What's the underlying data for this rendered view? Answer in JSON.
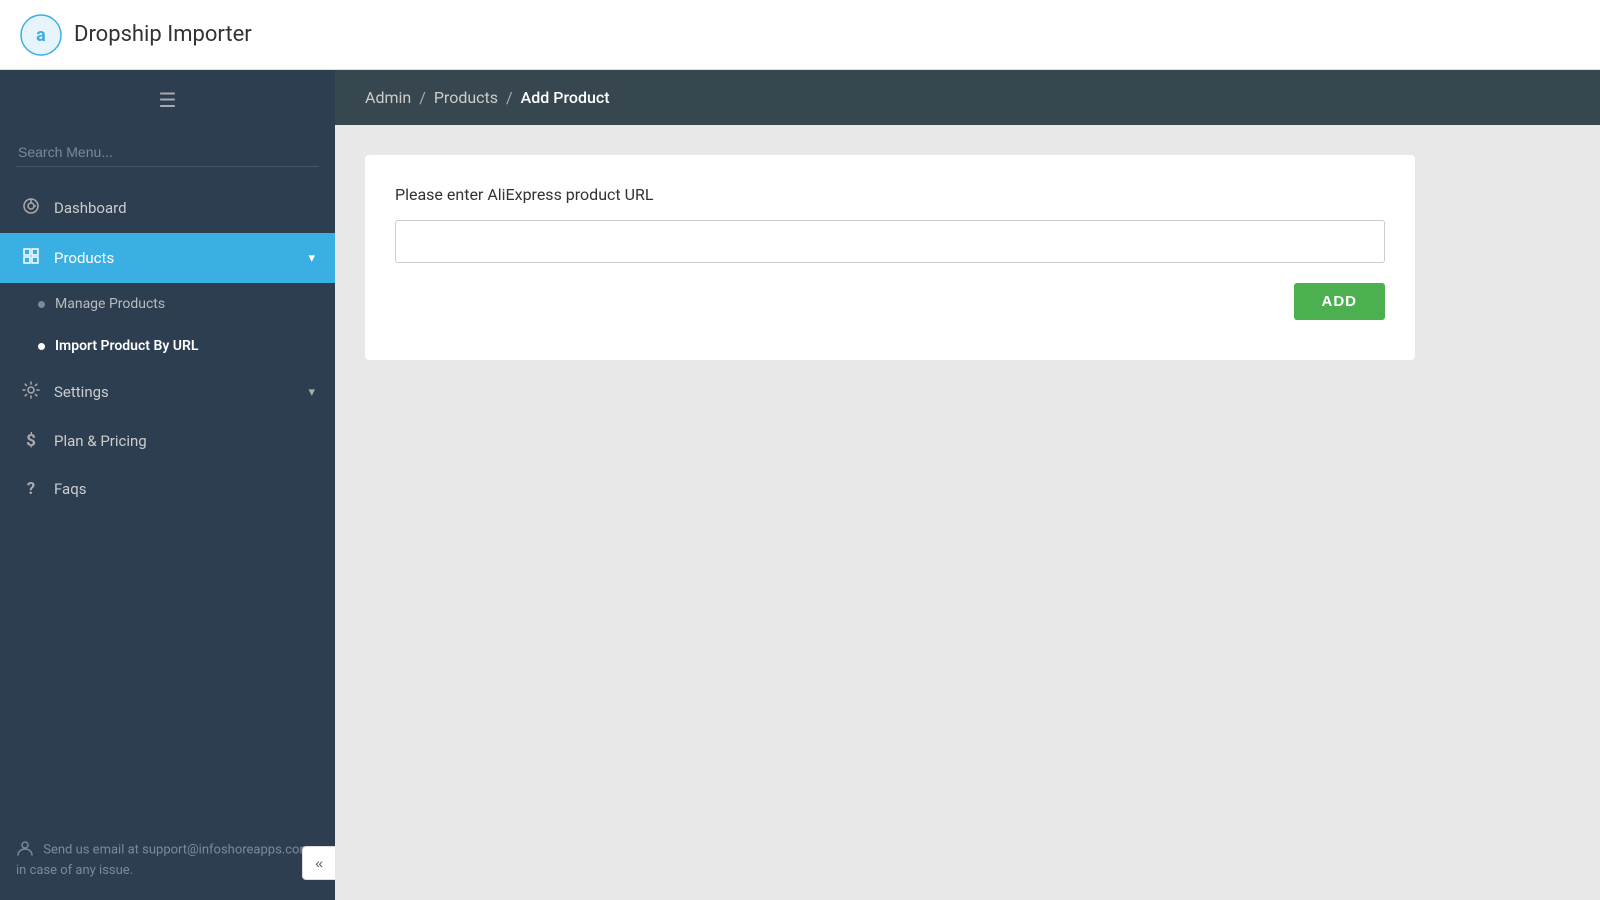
{
  "app": {
    "title": "Dropship Importer"
  },
  "sidebar": {
    "search_placeholder": "Search Menu...",
    "items": [
      {
        "id": "dashboard",
        "label": "Dashboard",
        "icon": "dashboard",
        "has_sub": false
      },
      {
        "id": "products",
        "label": "Products",
        "icon": "products",
        "has_sub": true,
        "active": true
      },
      {
        "id": "settings",
        "label": "Settings",
        "icon": "settings",
        "has_sub": true
      },
      {
        "id": "plan",
        "label": "Plan & Pricing",
        "icon": "dollar",
        "has_sub": false
      },
      {
        "id": "faqs",
        "label": "Faqs",
        "icon": "question",
        "has_sub": false
      }
    ],
    "subnav": [
      {
        "id": "manage-products",
        "label": "Manage Products",
        "active": false
      },
      {
        "id": "import-product",
        "label": "Import Product By URL",
        "active": true
      }
    ],
    "support_text": "Send us email at support@infoshoreapps.com in case of any issue.",
    "collapse_label": "«"
  },
  "header": {
    "breadcrumb": [
      {
        "label": "Admin",
        "active": false
      },
      {
        "label": "Products",
        "active": false
      },
      {
        "label": "Add Product",
        "active": true
      }
    ]
  },
  "main": {
    "card_label": "Please enter AliExpress product URL",
    "url_placeholder": "",
    "add_button_label": "ADD"
  }
}
